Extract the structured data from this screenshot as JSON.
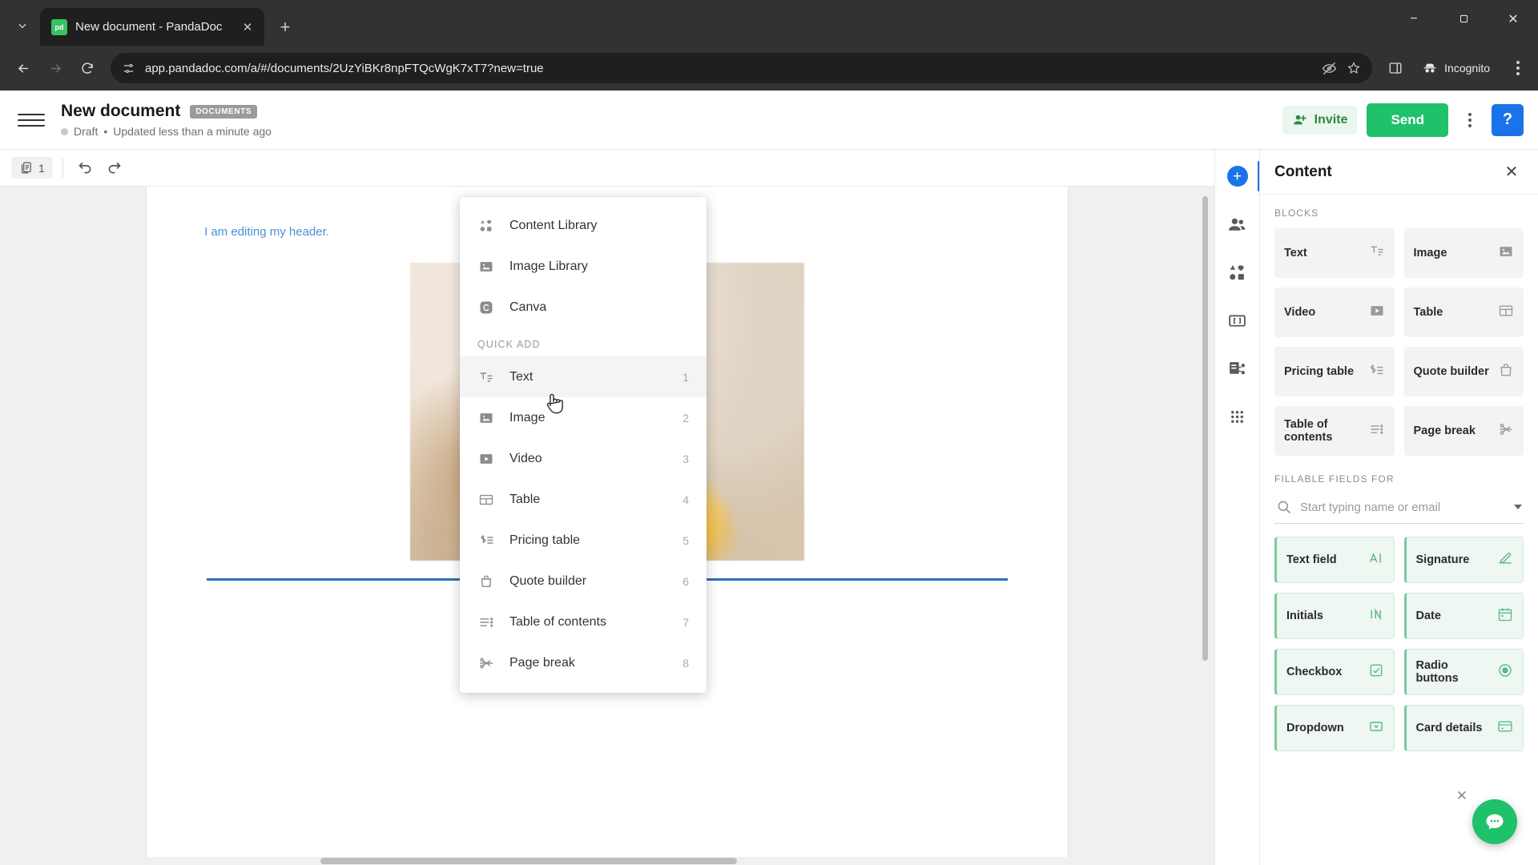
{
  "browser": {
    "tab": {
      "title": "New document - PandaDoc",
      "favicon_label": "pd"
    },
    "new_tab_label": "+",
    "url": "app.pandadoc.com/a/#/documents/2UzYiBKr8npFTQcWgK7xT7?new=true",
    "icons": {
      "tab_search": "chevron-down-icon",
      "back": "back-arrow-icon",
      "forward": "forward-arrow-icon",
      "reload": "reload-icon",
      "site_info": "site-settings-icon",
      "tracking": "eye-crossed-icon",
      "bookmark": "star-icon",
      "side_panel": "side-panel-icon",
      "incognito": "incognito-icon",
      "menu": "browser-menu-icon"
    },
    "incognito_label": "Incognito",
    "window": {
      "minimize": "−",
      "maximize": "❐",
      "close": "✕"
    }
  },
  "app_header": {
    "doc_title": "New document",
    "badge": "DOCUMENTS",
    "status": "Draft",
    "separator": "•",
    "updated": "Updated less than a minute ago",
    "invite_label": "Invite",
    "send_label": "Send",
    "help_label": "?"
  },
  "edit_toolbar": {
    "page_count": "1",
    "undo_title": "Undo",
    "redo_title": "Redo"
  },
  "document": {
    "header_text": "I am editing my header."
  },
  "menu": {
    "top_items": [
      {
        "label": "Content Library",
        "icon": "shapes-icon"
      },
      {
        "label": "Image Library",
        "icon": "image-icon"
      },
      {
        "label": "Canva",
        "icon": "canva-icon"
      }
    ],
    "section_label": "QUICK ADD",
    "quick_add": [
      {
        "label": "Text",
        "icon": "text-icon",
        "shortcut": "1"
      },
      {
        "label": "Image",
        "icon": "image-icon",
        "shortcut": "2"
      },
      {
        "label": "Video",
        "icon": "video-icon",
        "shortcut": "3"
      },
      {
        "label": "Table",
        "icon": "table-icon",
        "shortcut": "4"
      },
      {
        "label": "Pricing table",
        "icon": "pricing-table-icon",
        "shortcut": "5"
      },
      {
        "label": "Quote builder",
        "icon": "quote-builder-icon",
        "shortcut": "6"
      },
      {
        "label": "Table of contents",
        "icon": "toc-icon",
        "shortcut": "7"
      },
      {
        "label": "Page break",
        "icon": "page-break-icon",
        "shortcut": "8"
      }
    ]
  },
  "rail": [
    {
      "name": "add",
      "icon": "plus-icon",
      "active": true
    },
    {
      "name": "recipients",
      "icon": "people-icon",
      "active": false
    },
    {
      "name": "content-library",
      "icon": "shapes-icon",
      "active": false
    },
    {
      "name": "variables",
      "icon": "variables-icon",
      "active": false
    },
    {
      "name": "workflow",
      "icon": "workflow-icon",
      "active": false
    },
    {
      "name": "apps",
      "icon": "grid-apps-icon",
      "active": false
    }
  ],
  "panel": {
    "title": "Content",
    "close_label": "✕",
    "blocks_label": "BLOCKS",
    "blocks": [
      {
        "label": "Text",
        "icon": "text-icon"
      },
      {
        "label": "Image",
        "icon": "image-icon"
      },
      {
        "label": "Video",
        "icon": "video-icon"
      },
      {
        "label": "Table",
        "icon": "table-icon"
      },
      {
        "label": "Pricing table",
        "icon": "pricing-table-icon"
      },
      {
        "label": "Quote builder",
        "icon": "quote-builder-icon"
      },
      {
        "label": "Table of contents",
        "icon": "toc-icon"
      },
      {
        "label": "Page break",
        "icon": "page-break-icon"
      }
    ],
    "fillable_label": "FILLABLE FIELDS FOR",
    "assignee_placeholder": "Start typing name or email",
    "assignee_value": "",
    "fields": [
      {
        "label": "Text field",
        "icon": "text-field-icon"
      },
      {
        "label": "Signature",
        "icon": "signature-icon"
      },
      {
        "label": "Initials",
        "icon": "initials-icon"
      },
      {
        "label": "Date",
        "icon": "calendar-icon"
      },
      {
        "label": "Checkbox",
        "icon": "checkbox-icon"
      },
      {
        "label": "Radio buttons",
        "icon": "radio-icon"
      },
      {
        "label": "Dropdown",
        "icon": "dropdown-icon"
      },
      {
        "label": "Card details",
        "icon": "card-icon"
      }
    ]
  },
  "chat": {
    "icon": "chat-bubble-icon",
    "close": "✕"
  },
  "colors": {
    "accent_green": "#1fc16b",
    "accent_blue": "#1a73e8",
    "chrome_dark": "#323233",
    "doc_header_text": "#4a90d9",
    "doc_rule": "#2f6fb5"
  }
}
